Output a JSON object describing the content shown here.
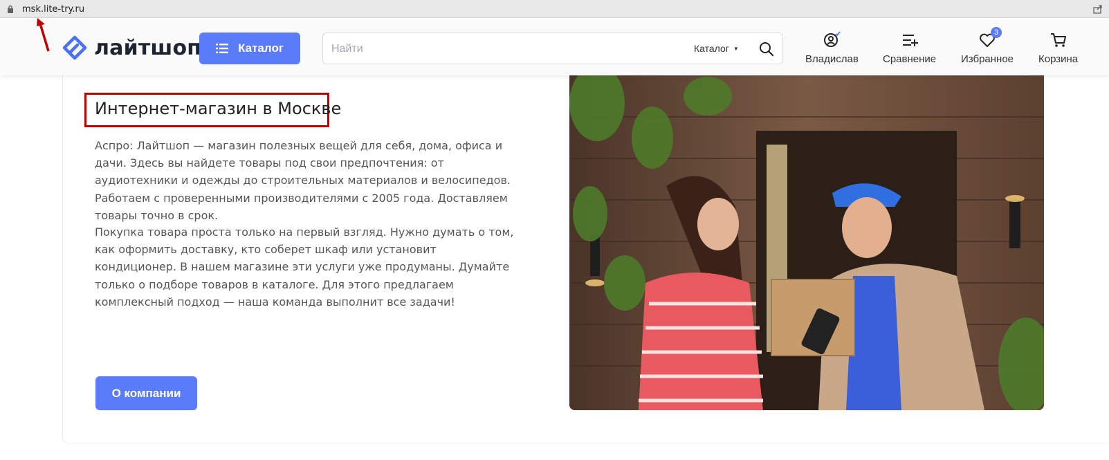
{
  "browser": {
    "url": "msk.lite-try.ru"
  },
  "header": {
    "logo_text": "лайтшоп",
    "catalog_button": "Каталог",
    "search": {
      "placeholder": "Найти",
      "scope": "Каталог"
    },
    "nav": [
      {
        "label": "Владислав",
        "icon": "user-icon"
      },
      {
        "label": "Сравнение",
        "icon": "compare-icon"
      },
      {
        "label": "Избранное",
        "icon": "heart-icon",
        "badge": "3"
      },
      {
        "label": "Корзина",
        "icon": "cart-icon"
      }
    ]
  },
  "main": {
    "title": "Интернет-магазин в Москве",
    "paragraph1": "Аспро: Лайтшоп — магазин полезных вещей для себя, дома, офиса и дачи. Здесь вы найдете товары под свои предпочтения: от аудиотехники и одежды до строительных материалов и велосипедов. Работаем с проверенными производителями с 2005 года. Доставляем товары точно в срок.",
    "paragraph2": "Покупка товара проста только на первый взгляд. Нужно думать о том, как оформить доставку, кто соберет шкаф или установит кондиционер. В нашем магазине эти услуги уже продуманы. Думайте только о подборе товаров в каталоге. Для этого предлагаем комплексный подход — наша команда выполнит все задачи!",
    "about_button": "О компании"
  },
  "colors": {
    "accent": "#5b7cfa",
    "annotation": "#c00000"
  }
}
